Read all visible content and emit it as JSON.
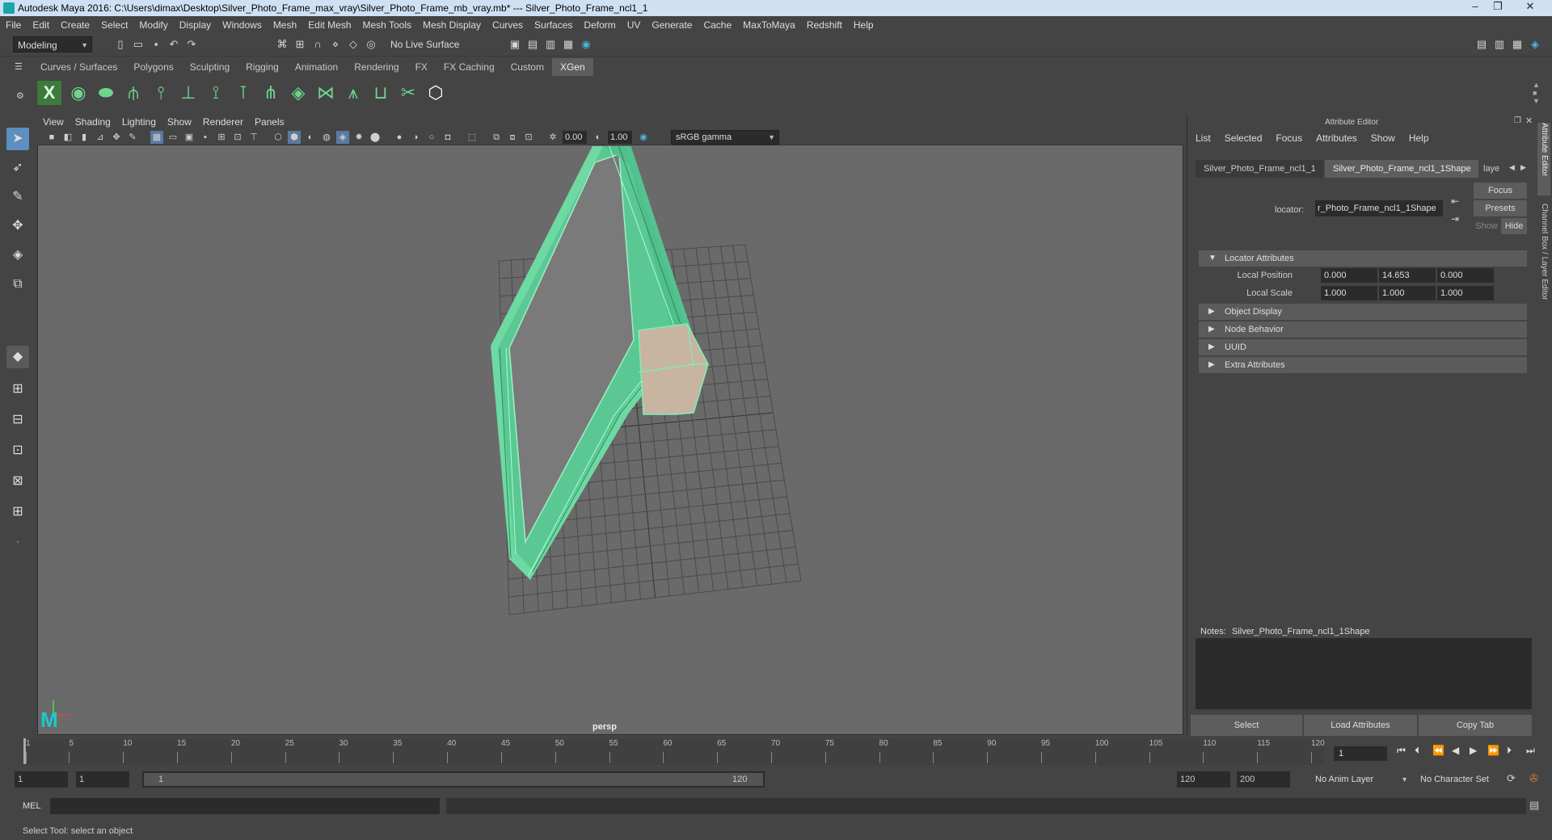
{
  "window": {
    "title": "Autodesk Maya 2016: C:\\Users\\dimax\\Desktop\\Silver_Photo_Frame_max_vray\\Silver_Photo_Frame_mb_vray.mb*   ---   Silver_Photo_Frame_ncl1_1",
    "minimize": "–",
    "maximize": "❐",
    "close": "✕"
  },
  "menubar": [
    "File",
    "Edit",
    "Create",
    "Select",
    "Modify",
    "Display",
    "Windows",
    "Mesh",
    "Edit Mesh",
    "Mesh Tools",
    "Mesh Display",
    "Curves",
    "Surfaces",
    "Deform",
    "UV",
    "Generate",
    "Cache",
    "MaxToMaya",
    "Redshift",
    "Help"
  ],
  "toolbar": {
    "mode": "Modeling",
    "live_surface": "No Live Surface"
  },
  "shelf_tabs": [
    "Curves / Surfaces",
    "Polygons",
    "Sculpting",
    "Rigging",
    "Animation",
    "Rendering",
    "FX",
    "FX Caching",
    "Custom",
    "XGen"
  ],
  "shelf_active": "XGen",
  "viewport": {
    "menu": [
      "View",
      "Shading",
      "Lighting",
      "Show",
      "Renderer",
      "Panels"
    ],
    "exposure": "0.00",
    "gamma": "1.00",
    "color_space": "sRGB gamma",
    "camera": "persp"
  },
  "attribute_editor": {
    "panel_title": "Attribute Editor",
    "menu": [
      "List",
      "Selected",
      "Focus",
      "Attributes",
      "Show",
      "Help"
    ],
    "tabs": [
      "Silver_Photo_Frame_ncl1_1",
      "Silver_Photo_Frame_ncl1_1Shape",
      "laye"
    ],
    "locator_label": "locator:",
    "locator_value": "r_Photo_Frame_ncl1_1Shape",
    "buttons": {
      "focus": "Focus",
      "presets": "Presets",
      "show": "Show",
      "hide": "Hide"
    },
    "sections": {
      "locator": "Locator Attributes",
      "object_display": "Object Display",
      "node_behavior": "Node Behavior",
      "uuid": "UUID",
      "extra": "Extra Attributes"
    },
    "local_position_label": "Local Position",
    "local_position": [
      "0.000",
      "14.653",
      "0.000"
    ],
    "local_scale_label": "Local Scale",
    "local_scale": [
      "1.000",
      "1.000",
      "1.000"
    ],
    "notes_label": "Notes:",
    "notes_name": "Silver_Photo_Frame_ncl1_1Shape",
    "bottom_buttons": [
      "Select",
      "Load Attributes",
      "Copy Tab"
    ]
  },
  "side_tabs": [
    "Attribute Editor",
    "Channel Box / Layer Editor"
  ],
  "timeline": {
    "ticks": [
      "1",
      "5",
      "10",
      "15",
      "20",
      "25",
      "30",
      "35",
      "40",
      "45",
      "50",
      "55",
      "60",
      "65",
      "70",
      "75",
      "80",
      "85",
      "90",
      "95",
      "100",
      "105",
      "110",
      "115",
      "120"
    ],
    "current_frame": "1"
  },
  "range": {
    "start": "1",
    "start2": "1",
    "slider_start": "1",
    "slider_end": "120",
    "end": "120",
    "end2": "200",
    "anim_layer": "No Anim Layer",
    "char_set": "No Character Set"
  },
  "mel": {
    "label": "MEL"
  },
  "help_line": "Select Tool: select an object"
}
